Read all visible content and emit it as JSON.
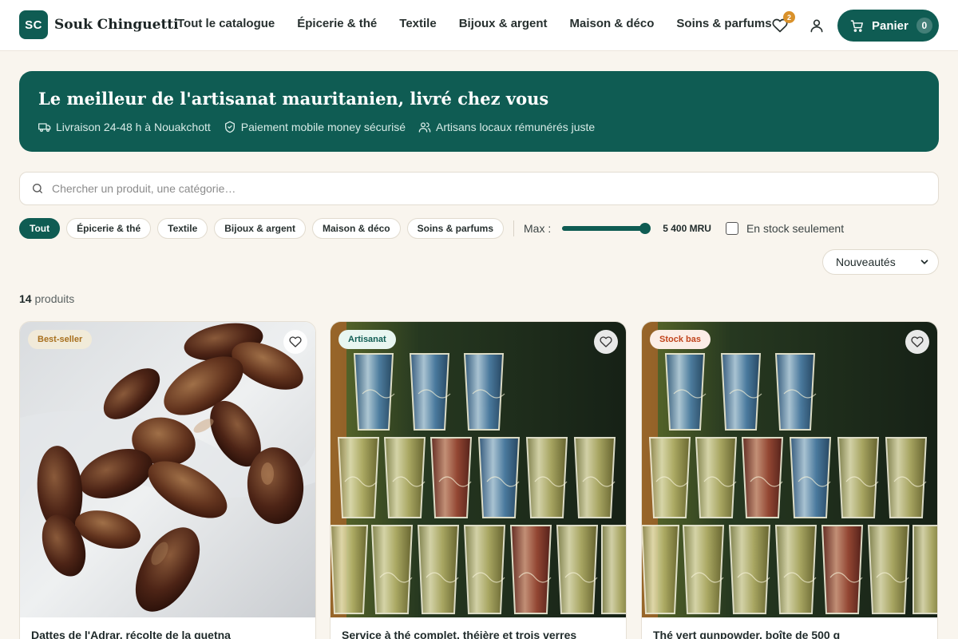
{
  "brand": {
    "badge": "SC",
    "name": "Souk Chinguetti"
  },
  "nav": [
    "Tout le catalogue",
    "Épicerie & thé",
    "Textile",
    "Bijoux & argent",
    "Maison & déco",
    "Soins & parfums"
  ],
  "header": {
    "favorites_count": "2",
    "cart_label": "Panier",
    "cart_count": "0"
  },
  "hero": {
    "title": "Le meilleur de l'artisanat mauritanien, livré chez vous",
    "features": [
      {
        "icon": "truck-icon",
        "text": "Livraison 24-48 h à Nouakchott"
      },
      {
        "icon": "shield-icon",
        "text": "Paiement mobile money sécurisé"
      },
      {
        "icon": "users-icon",
        "text": "Artisans locaux rémunérés juste"
      }
    ]
  },
  "search": {
    "placeholder": "Chercher un produit, une catégorie…"
  },
  "filters": {
    "chips": [
      "Tout",
      "Épicerie & thé",
      "Textile",
      "Bijoux & argent",
      "Maison & déco",
      "Soins & parfums"
    ],
    "active_index": 0,
    "max_label": "Max :",
    "max_value": "5 400 MRU",
    "slider_fraction": 0.94,
    "in_stock_label": "En stock seulement",
    "in_stock_checked": false
  },
  "sort": {
    "selected": "Nouveautés"
  },
  "results": {
    "count": "14",
    "suffix": "produits"
  },
  "products": [
    {
      "badge": "Best-seller",
      "badge_type": "best",
      "title": "Dattes de l'Adrar, récolte de la guetna",
      "image": "dates"
    },
    {
      "badge": "Artisanat",
      "badge_type": "art",
      "title": "Service à thé complet, théière et trois verres",
      "image": "tea-glasses"
    },
    {
      "badge": "Stock bas",
      "badge_type": "low",
      "title": "Thé vert gunpowder, boîte de 500 g",
      "image": "tea-glasses"
    }
  ],
  "colors": {
    "primary": "#0f5c53",
    "background": "#f9f5ee",
    "accent": "#d9912a"
  }
}
